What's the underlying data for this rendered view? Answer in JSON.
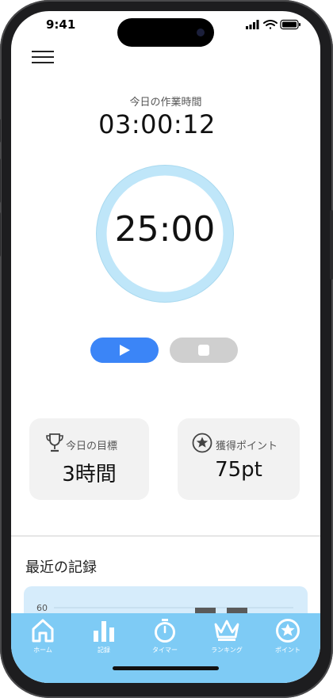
{
  "status_bar": {
    "time": "9:41"
  },
  "work": {
    "label": "今日の作業時間",
    "value": "03:00:12"
  },
  "timer": {
    "value": "25:00"
  },
  "cards": {
    "goal": {
      "label": "今日の目標",
      "value": "3時間"
    },
    "points": {
      "label": "獲得ポイント",
      "value": "75pt"
    }
  },
  "records": {
    "title": "最近の記録"
  },
  "chart_data": {
    "type": "bar",
    "tick_labels": [
      "60"
    ],
    "values": [
      60,
      60
    ],
    "bar_color": "#5a5a5a",
    "background": "#d6ecfb"
  },
  "tabs": [
    {
      "label": "ホーム",
      "icon": "home-icon"
    },
    {
      "label": "記録",
      "icon": "bar-chart-icon"
    },
    {
      "label": "タイマー",
      "icon": "stopwatch-icon"
    },
    {
      "label": "ランキング",
      "icon": "crown-icon"
    },
    {
      "label": "ポイント",
      "icon": "star-circle-icon"
    }
  ],
  "colors": {
    "accent": "#3b85f7",
    "ring": "#bfe6f9",
    "tab_bar": "#7ecbf5",
    "stop": "#cfcfcf"
  }
}
